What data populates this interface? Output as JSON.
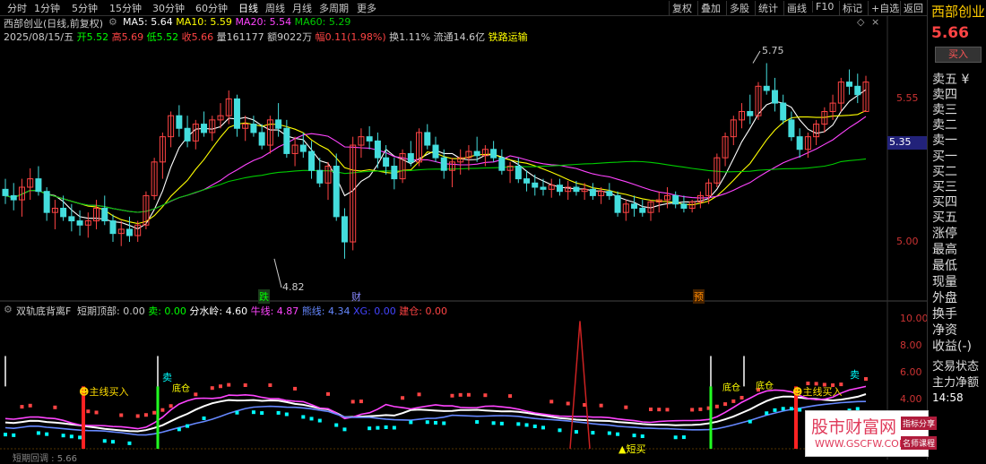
{
  "topbar": {
    "periods": [
      "分时",
      "1分钟",
      "5分钟",
      "15分钟",
      "30分钟",
      "60分钟",
      "日线",
      "周线",
      "月线",
      "多周期",
      "更多"
    ],
    "active_period": "日线",
    "tools": [
      "复权",
      "叠加",
      "多股",
      "统计",
      "画线",
      "F10",
      "标记",
      "+自选",
      "返回"
    ]
  },
  "header": {
    "title": "西部创业(日线,前复权)",
    "ma_labels": [
      {
        "text": "MA5: 5.64",
        "color": "#ffffff"
      },
      {
        "text": "MA10: 5.59",
        "color": "#ffff00"
      },
      {
        "text": "MA20: 5.54",
        "color": "#ff44ff"
      },
      {
        "text": "MA60: 5.29",
        "color": "#00cc00"
      }
    ],
    "quote": [
      {
        "text": "2025/08/15/五",
        "color": "#cccccc"
      },
      {
        "text": "开5.52",
        "color": "#00ff00"
      },
      {
        "text": "高5.69",
        "color": "#ff4444"
      },
      {
        "text": "低5.52",
        "color": "#00ff00"
      },
      {
        "text": "收5.66",
        "color": "#ff4444"
      },
      {
        "text": "量161177",
        "color": "#cccccc"
      },
      {
        "text": "额9022万",
        "color": "#cccccc"
      },
      {
        "text": "幅0.11(1.98%)",
        "color": "#ff4444"
      },
      {
        "text": "换1.11%",
        "color": "#cccccc"
      },
      {
        "text": "流通14.6亿",
        "color": "#cccccc"
      },
      {
        "text": "铁路运输",
        "color": "#ffff00"
      }
    ]
  },
  "price_axis": {
    "ticks": [
      "5.55",
      "5.00"
    ],
    "current_tag": "5.35"
  },
  "price_annotations": {
    "high": "5.75",
    "low": "4.82"
  },
  "event_markers": [
    {
      "text": "跌",
      "color": "#00ff00"
    },
    {
      "text": "财",
      "color": "#8888ff"
    },
    {
      "text": "预",
      "color": "#ff8800"
    }
  ],
  "indicator": {
    "name": "双轨底背离F",
    "values": [
      {
        "text": "短期顶部: 0.00",
        "color": "#cccccc"
      },
      {
        "text": "卖: 0.00",
        "color": "#00ff00"
      },
      {
        "text": "分水岭: 4.60",
        "color": "#ffffff"
      },
      {
        "text": "牛线: 4.87",
        "color": "#ff44ff"
      },
      {
        "text": "熊线: 4.34",
        "color": "#6688ff"
      },
      {
        "text": "XG: 0.00",
        "color": "#4444ff"
      },
      {
        "text": "建仓: 0.00",
        "color": "#ff4444"
      }
    ],
    "axis_ticks": [
      "10.00",
      "8.00",
      "6.00",
      "4.00"
    ],
    "signals": [
      "主线买入",
      "卖",
      "底仓",
      "短买",
      "底仓",
      "底仓",
      "主线买入",
      "卖"
    ]
  },
  "right_panel": {
    "stock_name": "西部创业",
    "price": "5.66",
    "buy_label": "买入",
    "items": [
      "卖五 ¥",
      "卖四",
      "卖三",
      "卖二",
      "卖一",
      "买一",
      "买二",
      "买三",
      "买四",
      "买五",
      "涨停",
      "最高",
      "最低",
      "现量",
      "外盘",
      "换手",
      "净资",
      "收益(-)",
      "交易状态",
      "主力净额",
      "14:58"
    ]
  },
  "bottom_text": "短期回调 : 5.66",
  "watermark": {
    "title": "股市财富网",
    "url": "WWW.GSCFW.COM",
    "tag1": "指标分享",
    "tag2": "名师课程"
  },
  "chart_data": {
    "type": "candlestick",
    "title": "西部创业(日线,前复权)",
    "y_range": [
      4.7,
      5.85
    ],
    "series": [
      {
        "name": "MA5",
        "color": "#ffffff"
      },
      {
        "name": "MA10",
        "color": "#ffff00"
      },
      {
        "name": "MA20",
        "color": "#ff44ff"
      },
      {
        "name": "MA60",
        "color": "#00cc00"
      }
    ],
    "last_candle": {
      "date": "2025/08/15",
      "open": 5.52,
      "high": 5.69,
      "low": 5.52,
      "close": 5.66,
      "volume": 161177
    },
    "ma_last": {
      "MA5": 5.64,
      "MA10": 5.59,
      "MA20": 5.54,
      "MA60": 5.29
    },
    "candles_approx": [
      [
        5.15,
        5.2,
        5.08,
        5.12
      ],
      [
        5.12,
        5.18,
        5.05,
        5.1
      ],
      [
        5.1,
        5.2,
        5.02,
        5.16
      ],
      [
        5.16,
        5.25,
        5.1,
        5.2
      ],
      [
        5.2,
        5.26,
        5.12,
        5.14
      ],
      [
        5.14,
        5.16,
        5.0,
        5.04
      ],
      [
        5.04,
        5.1,
        4.96,
        5.06
      ],
      [
        5.06,
        5.12,
        5.0,
        5.02
      ],
      [
        5.02,
        5.08,
        4.95,
        5.0
      ],
      [
        5.0,
        5.05,
        4.93,
        4.98
      ],
      [
        4.98,
        5.04,
        4.92,
        5.0
      ],
      [
        5.0,
        5.1,
        4.96,
        5.06
      ],
      [
        5.06,
        5.12,
        4.98,
        5.0
      ],
      [
        5.0,
        5.03,
        4.9,
        4.94
      ],
      [
        4.94,
        5.0,
        4.88,
        4.96
      ],
      [
        4.96,
        5.02,
        4.9,
        4.93
      ],
      [
        4.93,
        5.0,
        4.9,
        4.98
      ],
      [
        4.98,
        5.14,
        4.96,
        5.12
      ],
      [
        5.12,
        5.3,
        5.1,
        5.28
      ],
      [
        5.28,
        5.42,
        5.2,
        5.4
      ],
      [
        5.4,
        5.52,
        5.35,
        5.5
      ],
      [
        5.5,
        5.55,
        5.4,
        5.44
      ],
      [
        5.44,
        5.5,
        5.35,
        5.38
      ],
      [
        5.38,
        5.48,
        5.34,
        5.46
      ],
      [
        5.46,
        5.52,
        5.4,
        5.42
      ],
      [
        5.42,
        5.5,
        5.38,
        5.48
      ],
      [
        5.48,
        5.56,
        5.44,
        5.5
      ],
      [
        5.5,
        5.62,
        5.46,
        5.58
      ],
      [
        5.58,
        5.6,
        5.4,
        5.44
      ],
      [
        5.44,
        5.5,
        5.38,
        5.46
      ],
      [
        5.46,
        5.5,
        5.4,
        5.42
      ],
      [
        5.42,
        5.46,
        5.34,
        5.36
      ],
      [
        5.36,
        5.5,
        5.32,
        5.48
      ],
      [
        5.48,
        5.56,
        5.4,
        5.44
      ],
      [
        5.44,
        5.48,
        5.3,
        5.32
      ],
      [
        5.32,
        5.4,
        5.26,
        5.36
      ],
      [
        5.36,
        5.42,
        5.3,
        5.33
      ],
      [
        5.33,
        5.38,
        5.2,
        5.24
      ],
      [
        5.24,
        5.3,
        5.16,
        5.18
      ],
      [
        5.18,
        5.28,
        5.1,
        5.26
      ],
      [
        5.26,
        5.32,
        5.0,
        5.02
      ],
      [
        5.02,
        5.06,
        4.82,
        4.9
      ],
      [
        4.9,
        5.4,
        4.86,
        5.36
      ],
      [
        5.36,
        5.44,
        5.3,
        5.4
      ],
      [
        5.4,
        5.45,
        5.34,
        5.38
      ],
      [
        5.38,
        5.42,
        5.25,
        5.3
      ],
      [
        5.3,
        5.36,
        5.22,
        5.26
      ],
      [
        5.26,
        5.3,
        5.15,
        5.2
      ],
      [
        5.2,
        5.34,
        5.18,
        5.32
      ],
      [
        5.32,
        5.38,
        5.26,
        5.28
      ],
      [
        5.28,
        5.44,
        5.26,
        5.42
      ],
      [
        5.42,
        5.46,
        5.34,
        5.36
      ],
      [
        5.36,
        5.4,
        5.28,
        5.3
      ],
      [
        5.3,
        5.34,
        5.2,
        5.24
      ],
      [
        5.24,
        5.3,
        5.16,
        5.28
      ],
      [
        5.28,
        5.34,
        5.22,
        5.3
      ],
      [
        5.3,
        5.36,
        5.24,
        5.33
      ],
      [
        5.33,
        5.4,
        5.28,
        5.31
      ],
      [
        5.31,
        5.36,
        5.26,
        5.34
      ],
      [
        5.34,
        5.38,
        5.28,
        5.3
      ],
      [
        5.3,
        5.34,
        5.22,
        5.24
      ],
      [
        5.24,
        5.28,
        5.18,
        5.26
      ],
      [
        5.26,
        5.3,
        5.18,
        5.2
      ],
      [
        5.2,
        5.24,
        5.14,
        5.18
      ],
      [
        5.18,
        5.22,
        5.12,
        5.16
      ],
      [
        5.16,
        5.2,
        5.12,
        5.15
      ],
      [
        5.15,
        5.2,
        5.11,
        5.17
      ],
      [
        5.17,
        5.2,
        5.12,
        5.14
      ],
      [
        5.14,
        5.19,
        5.1,
        5.16
      ],
      [
        5.16,
        5.19,
        5.12,
        5.14
      ],
      [
        5.14,
        5.18,
        5.1,
        5.15
      ],
      [
        5.15,
        5.18,
        5.1,
        5.12
      ],
      [
        5.12,
        5.16,
        5.08,
        5.14
      ],
      [
        5.14,
        5.18,
        5.1,
        5.12
      ],
      [
        5.12,
        5.14,
        5.02,
        5.04
      ],
      [
        5.04,
        5.1,
        5.0,
        5.08
      ],
      [
        5.08,
        5.12,
        5.02,
        5.06
      ],
      [
        5.06,
        5.1,
        5.02,
        5.04
      ],
      [
        5.04,
        5.1,
        5.0,
        5.09
      ],
      [
        5.09,
        5.14,
        5.04,
        5.1
      ],
      [
        5.1,
        5.16,
        5.06,
        5.12
      ],
      [
        5.12,
        5.14,
        5.06,
        5.08
      ],
      [
        5.08,
        5.12,
        5.04,
        5.06
      ],
      [
        5.06,
        5.1,
        5.04,
        5.09
      ],
      [
        5.09,
        5.14,
        5.06,
        5.12
      ],
      [
        5.12,
        5.2,
        5.08,
        5.18
      ],
      [
        5.18,
        5.32,
        5.16,
        5.3
      ],
      [
        5.3,
        5.42,
        5.26,
        5.4
      ],
      [
        5.4,
        5.5,
        5.36,
        5.48
      ],
      [
        5.48,
        5.56,
        5.44,
        5.52
      ],
      [
        5.52,
        5.6,
        5.46,
        5.5
      ],
      [
        5.5,
        5.66,
        5.48,
        5.64
      ],
      [
        5.64,
        5.75,
        5.6,
        5.62
      ],
      [
        5.62,
        5.68,
        5.52,
        5.56
      ],
      [
        5.56,
        5.6,
        5.46,
        5.48
      ],
      [
        5.48,
        5.52,
        5.38,
        5.4
      ],
      [
        5.4,
        5.44,
        5.3,
        5.34
      ],
      [
        5.34,
        5.42,
        5.3,
        5.4
      ],
      [
        5.4,
        5.48,
        5.36,
        5.46
      ],
      [
        5.46,
        5.54,
        5.42,
        5.52
      ],
      [
        5.52,
        5.6,
        5.48,
        5.56
      ],
      [
        5.56,
        5.68,
        5.52,
        5.66
      ],
      [
        5.66,
        5.72,
        5.6,
        5.64
      ],
      [
        5.64,
        5.7,
        5.56,
        5.6
      ],
      [
        5.52,
        5.69,
        5.52,
        5.66
      ]
    ]
  }
}
